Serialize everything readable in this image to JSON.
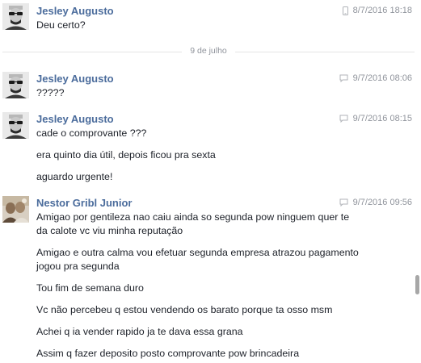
{
  "thread": {
    "date_divider": "9 de julho",
    "messages": [
      {
        "sender": "Jesley Augusto",
        "timestamp": "8/7/2016 18:18",
        "meta_icon": "mobile-icon",
        "lines": [
          "Deu certo?"
        ]
      },
      {
        "sender": "Jesley Augusto",
        "timestamp": "9/7/2016 08:06",
        "meta_icon": "chat-bubble-icon",
        "lines": [
          "?????"
        ]
      },
      {
        "sender": "Jesley Augusto",
        "timestamp": "9/7/2016 08:15",
        "meta_icon": "chat-bubble-icon",
        "lines": [
          "cade o comprovante ???",
          "era quinto dia útil, depois ficou pra sexta",
          "aguardo urgente!"
        ]
      },
      {
        "sender": "Nestor Gribl Junior",
        "timestamp": "9/7/2016 09:56",
        "meta_icon": "chat-bubble-icon",
        "lines": [
          "Amigao por gentileza  nao caiu ainda so segunda pow ninguem quer te",
          "da calote vc viu minha  reputação",
          "Amigao e outra calma vou efetuar segunda empresa atrazou pagamento",
          "jogou pra segunda",
          "Tou fim de semana duro",
          "Vc não percebeu q estou vendendo os barato porque ta osso msm",
          "Achei q ia vender rapido ja te dava essa grana",
          "Assim q fazer deposito posto comprovante  pow brincadeira"
        ]
      }
    ]
  },
  "colors": {
    "sender": "#4b6c9c",
    "text": "#1d2129",
    "meta": "#90949c"
  }
}
